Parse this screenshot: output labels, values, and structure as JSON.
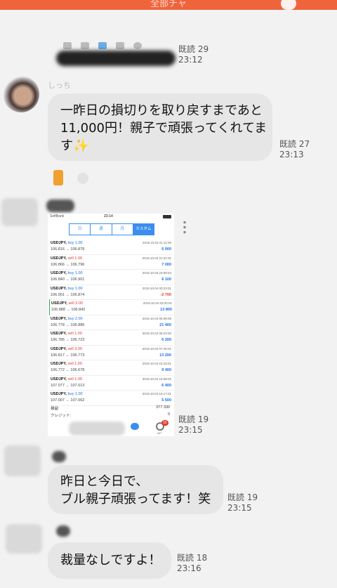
{
  "app": {
    "header_title": "全部チャ",
    "accent": "#f0643c"
  },
  "messages": [
    {
      "read": "既読 29",
      "time": "23:12"
    },
    {
      "sender": "しっち",
      "text": "一昨日の損切りを取り戻すまであと\n11,000円！親子で頑張ってくれてま\nす✨",
      "read": "既読 27",
      "time": "23:13"
    },
    {
      "read": "既読 19",
      "time": "23:15"
    },
    {
      "text": "昨日と今日で、\nブル親子頑張ってます！笑",
      "read": "既読 19",
      "time": "23:15"
    },
    {
      "text": "裁量なしですよ！",
      "read": "既読 18",
      "time": "23:16"
    }
  ],
  "shot": {
    "carrier": "SoftBank",
    "clock": "23:14",
    "tabs": [
      "日",
      "週",
      "月",
      "カスタム"
    ],
    "rows": [
      {
        "symbol": "USDJPY,",
        "side": "buy",
        "lot": "1.00",
        "prices": "106.816 → 106.878",
        "time": "2019.10.03 21:11:00",
        "pnl": "6 000"
      },
      {
        "symbol": "USDJPY,",
        "side": "sell",
        "lot": "1.00",
        "prices": "106.866 → 106.796",
        "time": "2019.10.03 21:31:01",
        "pnl": "7 000"
      },
      {
        "symbol": "USDJPY,",
        "side": "buy",
        "lot": "1.00",
        "prices": "106.840 → 106.901",
        "time": "2019.10.03 23:08:04",
        "pnl": "6 100"
      },
      {
        "symbol": "USDJPY,",
        "side": "buy",
        "lot": "1.00",
        "prices": "106.901 → 106.874",
        "time": "2019.10.04 00:23:01",
        "pnl": "-2 700"
      },
      {
        "symbol": "USDJPY,",
        "side": "sell",
        "lot": "3.00",
        "prices": "106.888 → 106.842",
        "time": "2019.10.04 03:20:01",
        "pnl": "13 800"
      },
      {
        "symbol": "USDJPY,",
        "side": "buy",
        "lot": "2.00",
        "prices": "106.778 → 106.885",
        "time": "2019.10.04 05:08:08",
        "pnl": "21 400"
      },
      {
        "symbol": "USDJPY,",
        "side": "sell",
        "lot": "1.00",
        "prices": "106.785 → 106.723",
        "time": "2019.10.04 06:23:00",
        "pnl": "6 200"
      },
      {
        "symbol": "USDJPY,",
        "side": "sell",
        "lot": "3.00",
        "prices": "106.817 → 106.773",
        "time": "2019.10.04 07:45:01",
        "pnl": "13 200"
      },
      {
        "symbol": "USDJPY,",
        "side": "sell",
        "lot": "1.00",
        "prices": "106.772 → 106.678",
        "time": "2019.10.04 15:15:01",
        "pnl": "9 400"
      },
      {
        "symbol": "USDJPY,",
        "side": "sell",
        "lot": "1.00",
        "prices": "107.077 → 107.013",
        "time": "2019.10.04 15:58:02",
        "pnl": "6 400"
      },
      {
        "symbol": "USDJPY,",
        "side": "buy",
        "lot": "1.00",
        "prices": "107.007 → 107.062",
        "time": "2019.10.04 16:17:01",
        "pnl": "5 500"
      }
    ],
    "profit_label": "損益:",
    "profit_value": "377 330",
    "credit_label": "クレジット:",
    "credit_value": "0",
    "badge": "10",
    "tab_label": "MP"
  }
}
